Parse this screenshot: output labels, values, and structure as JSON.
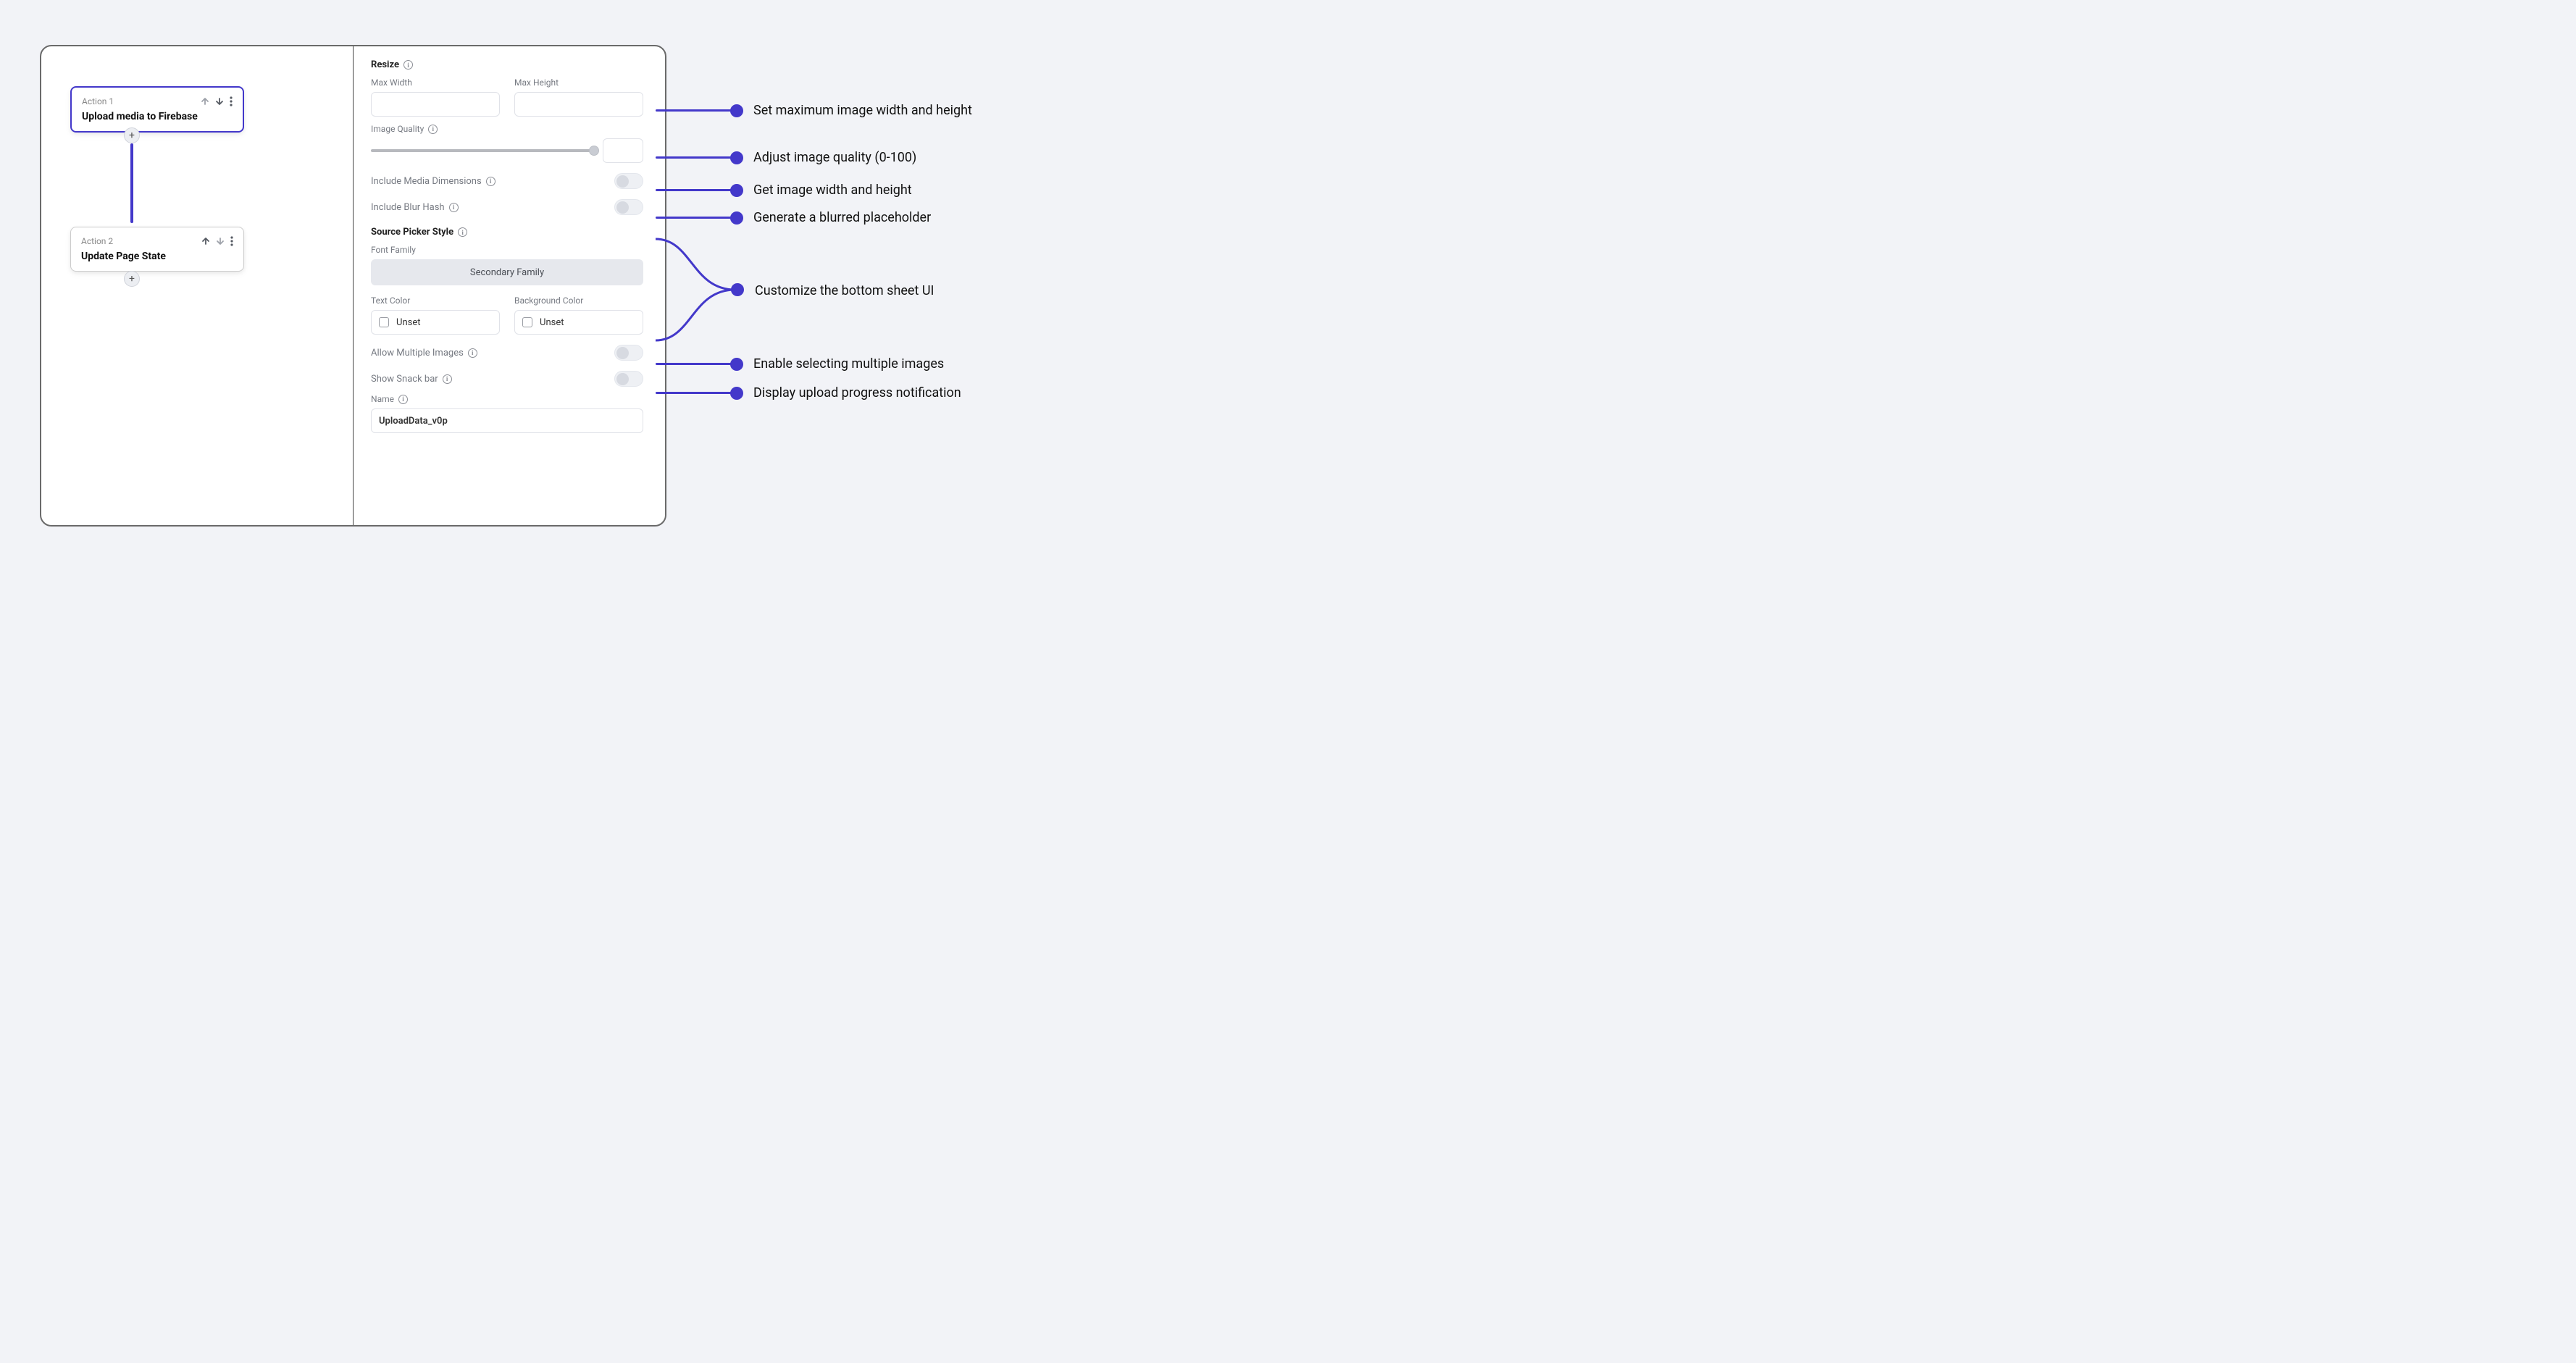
{
  "actions": {
    "a1": {
      "header": "Action 1",
      "title": "Upload media to Firebase"
    },
    "a2": {
      "header": "Action 2",
      "title": "Update Page State"
    }
  },
  "form": {
    "resize": "Resize",
    "maxWidth": "Max Width",
    "maxHeight": "Max Height",
    "imageQuality": "Image Quality",
    "includeDims": "Include Media Dimensions",
    "includeBlur": "Include Blur Hash",
    "srcPicker": "Source Picker Style",
    "fontFamily": "Font Family",
    "fontFamilyValue": "Secondary Family",
    "textColor": "Text Color",
    "bgColor": "Background Color",
    "unset": "Unset",
    "allowMultiple": "Allow Multiple Images",
    "snackbar": "Show Snack bar",
    "nameLabel": "Name",
    "nameValue": "UploadData_v0p"
  },
  "callouts": {
    "dims": "Set maximum image width and height",
    "quality": "Adjust image quality (0-100)",
    "getdims": "Get image width and height",
    "blur": "Generate a blurred placeholder",
    "picker": "Customize the bottom sheet UI",
    "multi": "Enable selecting multiple images",
    "snack": "Display upload progress notification"
  },
  "colors": {
    "accent": "#4338ca"
  }
}
